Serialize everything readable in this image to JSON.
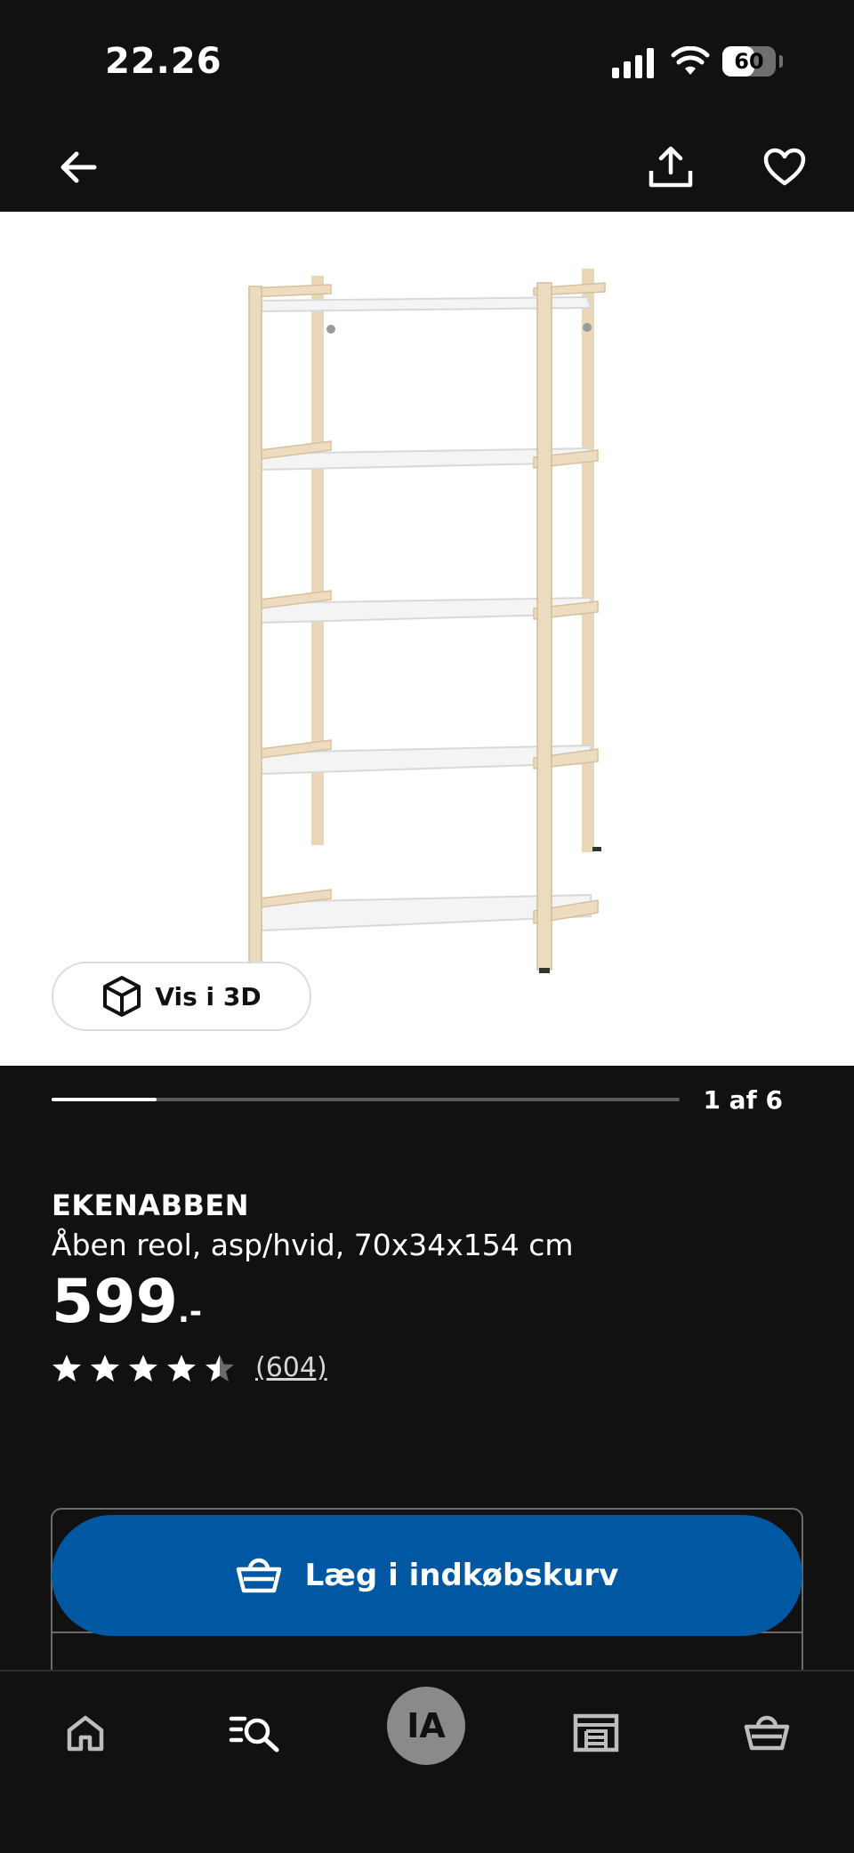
{
  "status_bar": {
    "time": "22.26",
    "battery_level": "60",
    "battery_fraction": 0.6
  },
  "nav": {
    "back_icon": "arrow-left-icon",
    "share_icon": "share-icon",
    "favorite_icon": "heart-icon"
  },
  "image_viewer": {
    "view_3d_label": "Vis i 3D",
    "view_3d_icon": "cube-icon",
    "position_label": "1 af 6",
    "progress_fraction": 0.167
  },
  "product": {
    "name": "EKENABBEN",
    "description": "Åben reol, asp/hvid, 70x34x154 cm",
    "price": "599",
    "price_suffix": ".-",
    "rating_value": 4.5,
    "rating_max": 5,
    "review_count": "(604)"
  },
  "add_to_cart": {
    "label": "Læg i indkøbskurv",
    "icon": "basket-icon",
    "color": "#0058a3"
  },
  "tabs": [
    {
      "name": "home",
      "icon": "home-icon"
    },
    {
      "name": "search",
      "icon": "search-icon"
    },
    {
      "name": "profile",
      "initials": "IA"
    },
    {
      "name": "stores",
      "icon": "store-icon"
    },
    {
      "name": "cart",
      "icon": "basket-icon"
    }
  ],
  "colors": {
    "background": "#111111",
    "accent_blue": "#0058a3",
    "image_bg": "#ffffff"
  }
}
